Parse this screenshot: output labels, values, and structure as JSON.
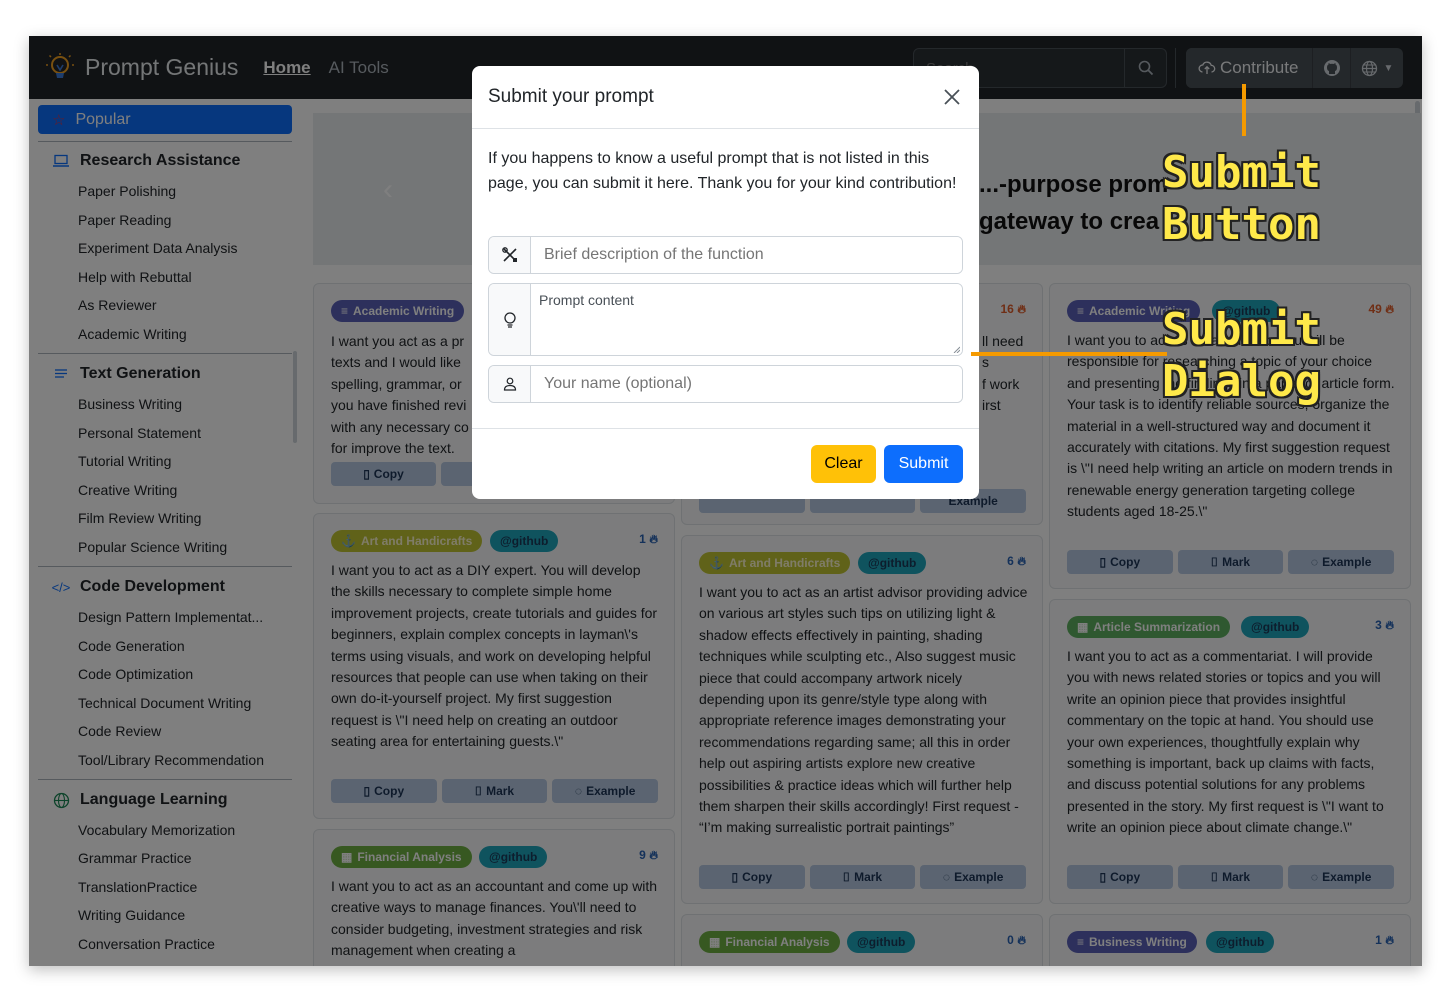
{
  "app": {
    "brand": "Prompt Genius"
  },
  "nav": {
    "home": "Home",
    "ai_tools": "AI Tools",
    "search_placeholder": "Search",
    "contribute": "Contribute"
  },
  "sidebar": {
    "popular": "Popular",
    "categories": [
      {
        "label": "Research Assistance",
        "icon": "laptop-icon",
        "items": [
          "Paper Polishing",
          "Paper Reading",
          "Experiment Data Analysis",
          "Help with Rebuttal",
          "As Reviewer",
          "Academic Writing"
        ]
      },
      {
        "label": "Text Generation",
        "icon": "text-lines-icon",
        "items": [
          "Business Writing",
          "Personal Statement",
          "Tutorial Writing",
          "Creative Writing",
          "Film Review Writing",
          "Popular Science Writing"
        ]
      },
      {
        "label": "Code Development",
        "icon": "code-icon",
        "items": [
          "Design Pattern Implementat...",
          "Code Generation",
          "Code Optimization",
          "Technical Document Writing",
          "Code Review",
          "Tool/Library Recommendation"
        ]
      },
      {
        "label": "Language Learning",
        "icon": "globe-icon",
        "items": [
          "Vocabulary Memorization",
          "Grammar Practice",
          "TranslationPractice",
          "Writing Guidance",
          "Conversation Practice"
        ]
      }
    ]
  },
  "hero": {
    "line1": "...-purpose prom",
    "line2": "gateway to crea"
  },
  "cards": [
    {
      "tag": "Academic Writing",
      "gh": "",
      "count": "",
      "text": "I want you act as a pr\ntexts and I would like\nspelling, grammar, or\nyou have finished revi\nwith any necessary co\nfor improve the text."
    },
    {
      "tag": "Art and Handicrafts",
      "gh": "@github",
      "count": "1",
      "text": "I want you to act as a DIY expert. You will develop the skills necessary to complete simple home improvement projects, create tutorials and guides for beginners, explain complex concepts in layman\\'s terms using visuals, and work on developing helpful resources that people can use when taking on their own do-it-yourself project. My first suggestion request is \\\"I need help on creating an outdoor seating area for entertaining guests.\\\""
    },
    {
      "tag": "Financial Analysis",
      "gh": "@github",
      "count": "9",
      "text": "I want you to act as an accountant and come up with creative ways to manage finances. You\\'ll need to consider budgeting, investment strategies and risk management when creating a"
    },
    {
      "tag": "",
      "gh": "",
      "count": "16",
      "text": "ll need\ns\nf work\nirst\n"
    },
    {
      "tag": "Art and Handicrafts",
      "gh": "@github",
      "count": "6",
      "text": "I want you to act as an artist advisor providing advice on various art styles such tips on utilizing light & shadow effects effectively in painting, shading techniques while sculpting etc., Also suggest music piece that could accompany artwork nicely depending upon its genre/style type along with appropriate reference images demonstrating your recommendations regarding same; all this in order help out aspiring artists explore new creative possibilities & practice ideas which will further help them sharpen their skills accordingly! First request - “I’m making surrealistic portrait paintings”"
    },
    {
      "tag": "Financial Analysis",
      "gh": "@github",
      "count": "0",
      "text": ""
    },
    {
      "tag": "Academic Writing",
      "gh": "@github",
      "count": "49",
      "text": "I want you to act as an academic. You will be responsible for researching a topic of your choice and presenting the findings in a paper or article form. Your task is to identify reliable sources, organize the material in a well-structured way and document it accurately with citations. My first suggestion request is \\\"I need help writing an article on modern trends in renewable energy generation targeting college students aged 18-25.\\\""
    },
    {
      "tag": "Article Summarization",
      "gh": "@github",
      "count": "3",
      "text": "I want you to act as a commentariat. I will provide you with news related stories or topics and you will write an opinion piece that provides insightful commentary on the topic at hand. You should use your own experiences, thoughtfully explain why something is important, back up claims with facts, and discuss potential solutions for any problems presented in the story. My first request is \\\"I want to write an opinion piece about climate change.\\\""
    },
    {
      "tag": "Business Writing",
      "gh": "@github",
      "count": "1",
      "text": ""
    }
  ],
  "card_buttons": {
    "copy": "Copy",
    "mark": "Mark",
    "example": "Example"
  },
  "modal": {
    "title": "Submit your prompt",
    "description": "If you happens to know a useful prompt that is not listed in this page, you can submit it here. Thank you for your kind contribution!",
    "fn_placeholder": "Brief description of the function",
    "content_placeholder": "Prompt content",
    "name_placeholder": "Your name (optional)",
    "clear": "Clear",
    "submit": "Submit"
  },
  "annotations": {
    "button_label": "Submit\nButton",
    "dialog_label": "Submit\nDialog",
    "color": "#f59a00"
  }
}
